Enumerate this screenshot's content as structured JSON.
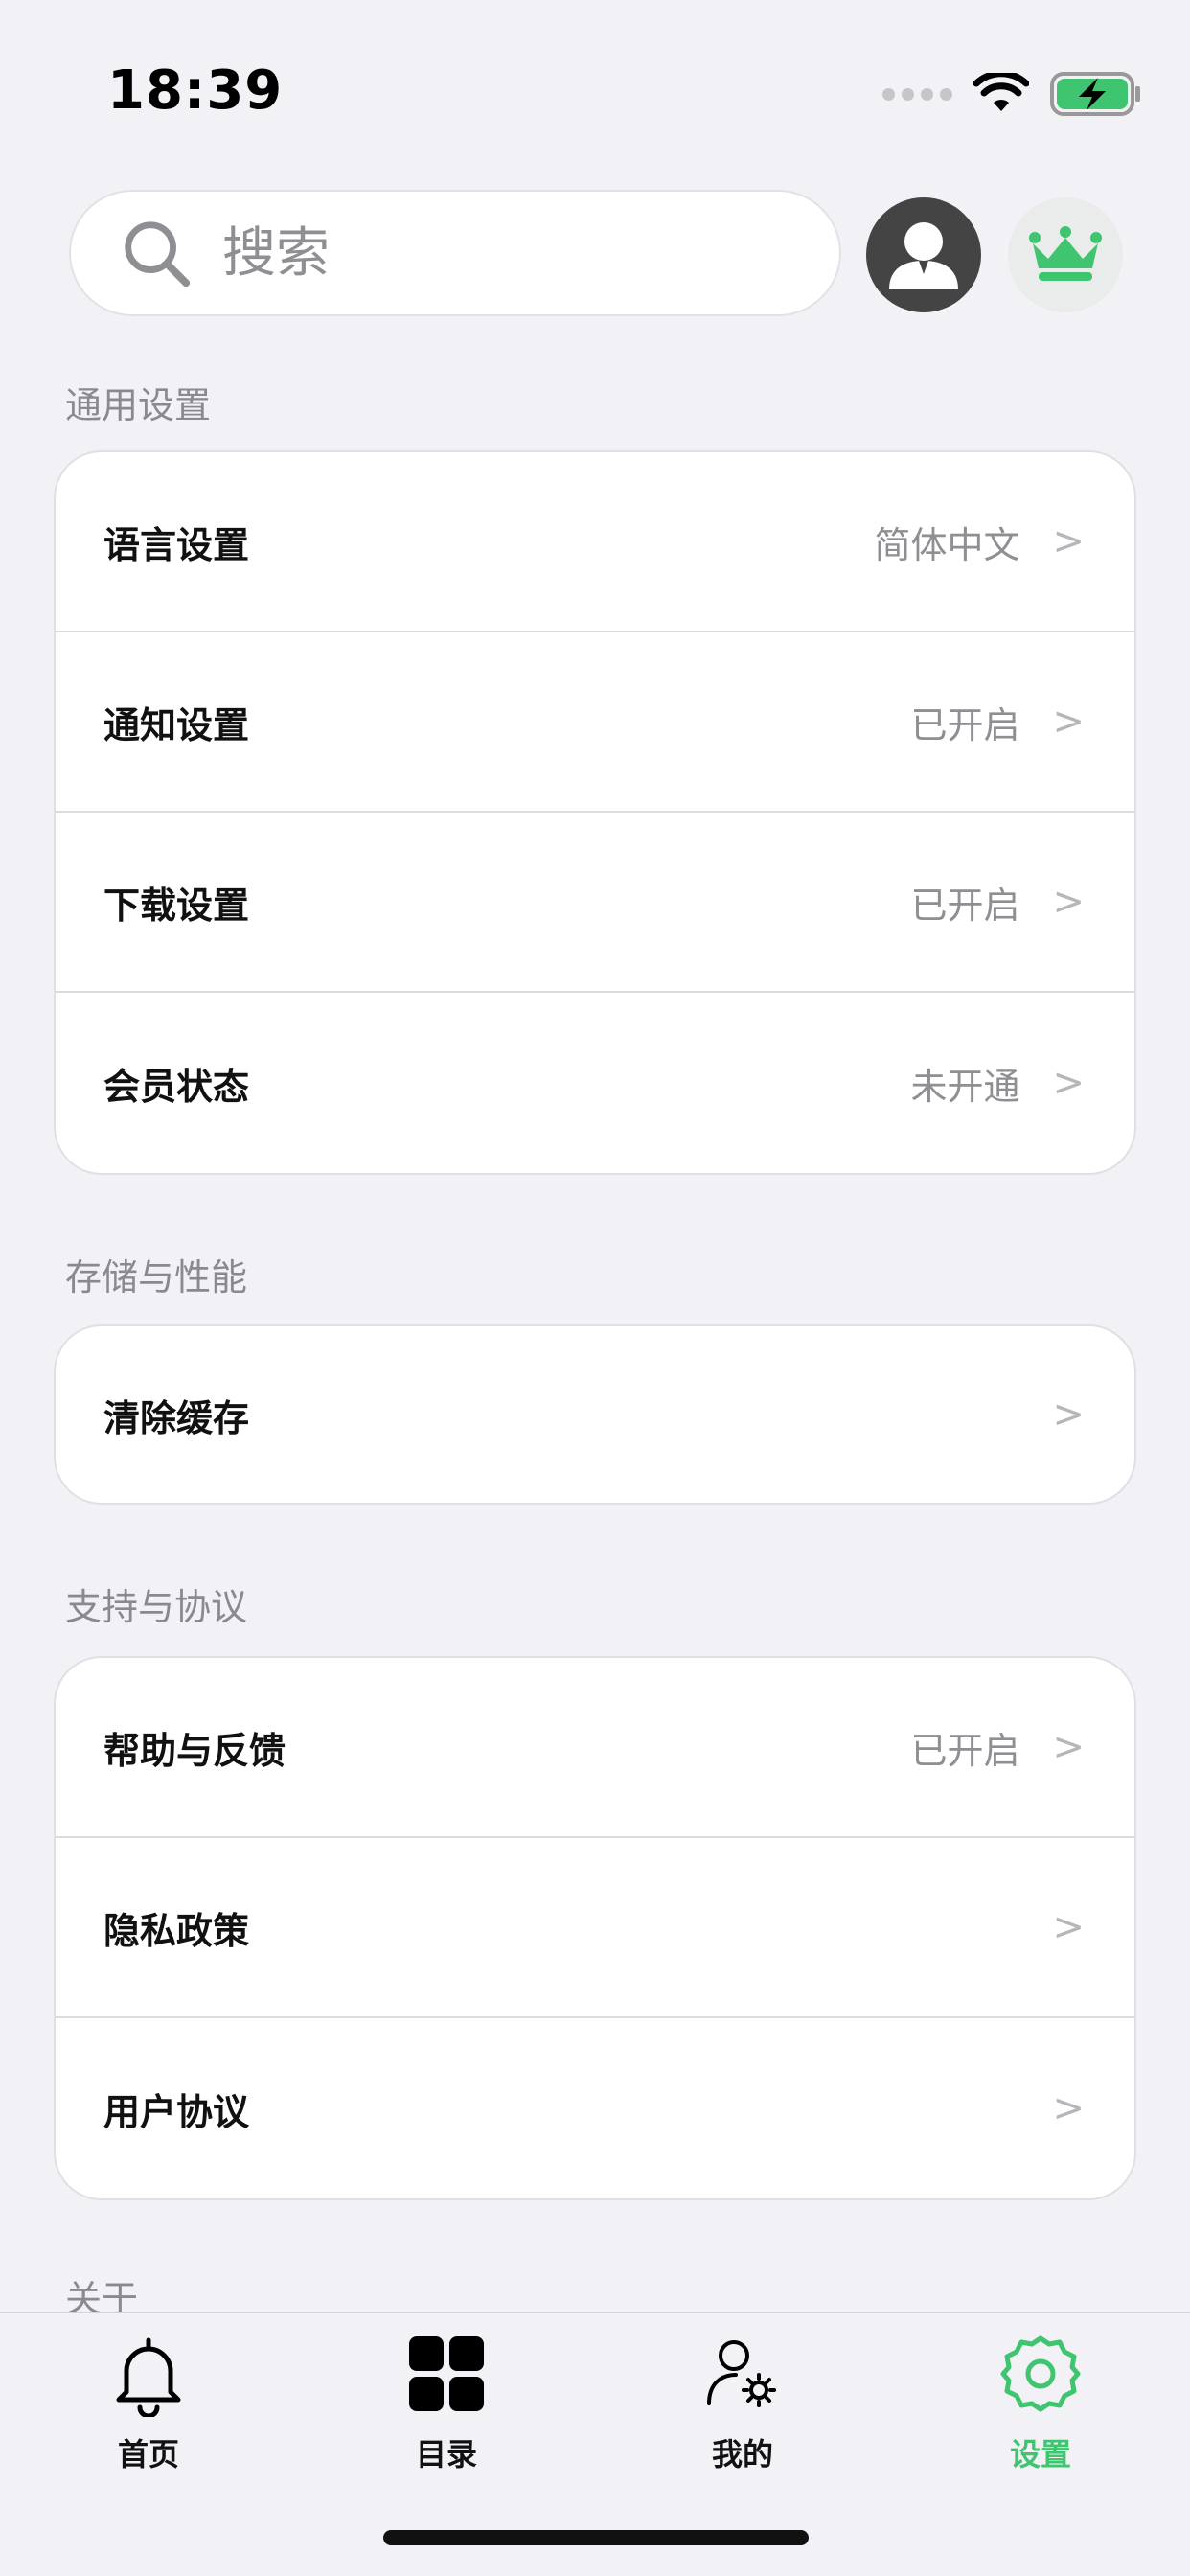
{
  "status_bar": {
    "time": "18:39"
  },
  "search": {
    "placeholder": "搜索",
    "value": ""
  },
  "header": {
    "avatar_icon": "user-avatar-icon",
    "crown_icon": "crown-icon",
    "accent_color": "#3fc46f"
  },
  "sections": [
    {
      "title": "通用设置",
      "rows": [
        {
          "label": "语言设置",
          "value": "简体中文",
          "chevron": ">"
        },
        {
          "label": "通知设置",
          "value": "已开启",
          "chevron": ">"
        },
        {
          "label": "下载设置",
          "value": "已开启",
          "chevron": ">"
        },
        {
          "label": "会员状态",
          "value": "未开通",
          "chevron": ">"
        }
      ]
    },
    {
      "title": "存储与性能",
      "rows": [
        {
          "label": "清除缓存",
          "value": "",
          "chevron": ">"
        }
      ]
    },
    {
      "title": "支持与协议",
      "rows": [
        {
          "label": "帮助与反馈",
          "value": "已开启",
          "chevron": ">"
        },
        {
          "label": "隐私政策",
          "value": "",
          "chevron": ">"
        },
        {
          "label": "用户协议",
          "value": "",
          "chevron": ">"
        }
      ]
    },
    {
      "title": "关于",
      "rows": []
    }
  ],
  "tabbar": {
    "items": [
      {
        "label": "首页",
        "icon": "bell-icon",
        "active": false
      },
      {
        "label": "目录",
        "icon": "grid-icon",
        "active": false
      },
      {
        "label": "我的",
        "icon": "user-settings-icon",
        "active": false
      },
      {
        "label": "设置",
        "icon": "gear-icon",
        "active": true
      }
    ]
  }
}
